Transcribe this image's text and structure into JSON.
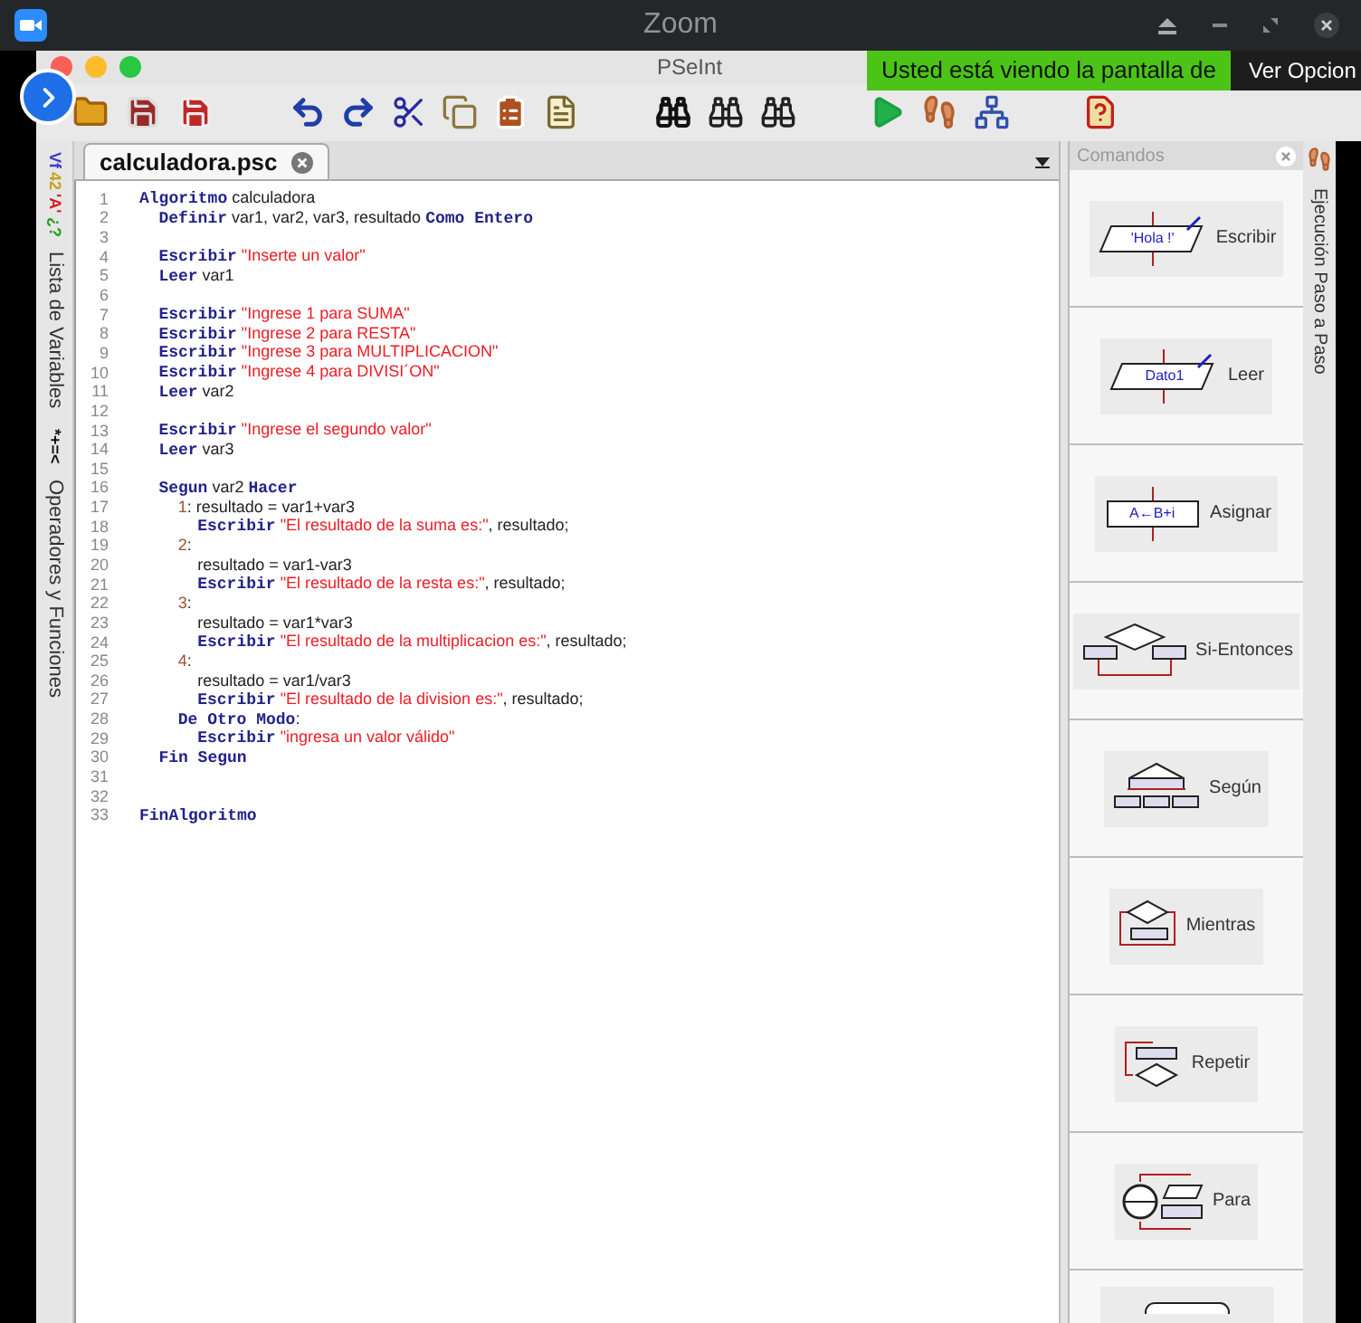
{
  "zoom_window": {
    "title": "Zoom"
  },
  "pseint_window": {
    "title": "PSeInt"
  },
  "share_banner": {
    "text": "Usted está viendo la pantalla de",
    "options": "Ver Opcion"
  },
  "left_tabs": [
    {
      "icon_text": [
        {
          "text": "Vf",
          "color": "#3a3ad0"
        },
        {
          "text": "42",
          "color": "#c8a020"
        },
        {
          "text": "'A'",
          "color": "#d02020"
        },
        {
          "text": "¿?",
          "color": "#20a020"
        }
      ],
      "label": "Lista de Variables"
    },
    {
      "icon_text": [
        {
          "text": "*+=<",
          "color": "#111111"
        }
      ],
      "label": "Operadores y Funciones"
    }
  ],
  "editor": {
    "tab": {
      "label": "calculadora.psc",
      "selected": true
    },
    "lines": [
      {
        "n": "1",
        "tokens": [
          {
            "kind": "keyword",
            "text": "Algoritmo"
          },
          {
            "kind": "text",
            "text": " calculadora"
          }
        ],
        "children": [
          {
            "n": "2",
            "tokens": [
              {
                "kind": "keyword",
                "text": "Definir"
              },
              {
                "kind": "text",
                "text": " var1, var2, var3, resultado "
              },
              {
                "kind": "keyword",
                "text": "Como Entero"
              }
            ]
          },
          {
            "n": "3"
          },
          {
            "n": "4",
            "tokens": [
              {
                "kind": "keyword",
                "text": "Escribir"
              },
              {
                "kind": "string",
                "text": " \"Inserte un valor\""
              }
            ]
          },
          {
            "n": "5",
            "tokens": [
              {
                "kind": "keyword",
                "text": "Leer"
              },
              {
                "kind": "text",
                "text": " var1"
              }
            ]
          },
          {
            "n": "6"
          },
          {
            "n": "7",
            "tokens": [
              {
                "kind": "keyword",
                "text": "Escribir"
              },
              {
                "kind": "string",
                "text": " \"Ingrese 1 para SUMA\""
              }
            ]
          },
          {
            "n": "8",
            "tokens": [
              {
                "kind": "keyword",
                "text": "Escribir"
              },
              {
                "kind": "string",
                "text": " \"Ingrese 2 para RESTA\""
              }
            ]
          },
          {
            "n": "9",
            "tokens": [
              {
                "kind": "keyword",
                "text": "Escribir"
              },
              {
                "kind": "string",
                "text": " \"Ingrese 3 para MULTIPLICACION\""
              }
            ]
          },
          {
            "n": "10",
            "tokens": [
              {
                "kind": "keyword",
                "text": "Escribir"
              },
              {
                "kind": "string",
                "text": " \"Ingrese 4 para DIVISI´ON\""
              }
            ]
          },
          {
            "n": "11",
            "tokens": [
              {
                "kind": "keyword",
                "text": "Leer"
              },
              {
                "kind": "text",
                "text": " var2"
              }
            ]
          },
          {
            "n": "12"
          },
          {
            "n": "13",
            "tokens": [
              {
                "kind": "keyword",
                "text": "Escribir"
              },
              {
                "kind": "string",
                "text": " \"Ingrese el segundo valor\""
              }
            ]
          },
          {
            "n": "14",
            "tokens": [
              {
                "kind": "keyword",
                "text": "Leer"
              },
              {
                "kind": "text",
                "text": " var3"
              }
            ]
          },
          {
            "n": "15"
          },
          {
            "n": "16",
            "tokens": [
              {
                "kind": "keyword",
                "text": "Segun"
              },
              {
                "kind": "text",
                "text": " var2 "
              },
              {
                "kind": "keyword",
                "text": "Hacer"
              }
            ],
            "children": [
              {
                "n": "17",
                "tokens": [
                  {
                    "kind": "number",
                    "text": "1"
                  },
                  {
                    "kind": "text",
                    "text": ": resultado = var1+var3"
                  }
                ],
                "children": [
                  {
                    "n": "18",
                    "tokens": [
                      {
                        "kind": "keyword",
                        "text": "Escribir"
                      },
                      {
                        "kind": "string",
                        "text": " \"El resultado de la suma es:\""
                      },
                      {
                        "kind": "text",
                        "text": ", resultado;"
                      }
                    ]
                  }
                ]
              },
              {
                "n": "19",
                "tokens": [
                  {
                    "kind": "number",
                    "text": "2"
                  },
                  {
                    "kind": "text",
                    "text": ":"
                  }
                ],
                "children": [
                  {
                    "n": "20",
                    "tokens": [
                      {
                        "kind": "text",
                        "text": "resultado = var1-var3"
                      }
                    ]
                  },
                  {
                    "n": "21",
                    "tokens": [
                      {
                        "kind": "keyword",
                        "text": "Escribir"
                      },
                      {
                        "kind": "string",
                        "text": " \"El resultado de la resta es:\""
                      },
                      {
                        "kind": "text",
                        "text": ", resultado;"
                      }
                    ]
                  }
                ]
              },
              {
                "n": "22",
                "tokens": [
                  {
                    "kind": "number",
                    "text": "3"
                  },
                  {
                    "kind": "text",
                    "text": ":"
                  }
                ],
                "children": [
                  {
                    "n": "23",
                    "tokens": [
                      {
                        "kind": "text",
                        "text": "resultado = var1*var3"
                      }
                    ]
                  },
                  {
                    "n": "24",
                    "tokens": [
                      {
                        "kind": "keyword",
                        "text": "Escribir"
                      },
                      {
                        "kind": "string",
                        "text": " \"El resultado de la multiplicacion es:\""
                      },
                      {
                        "kind": "text",
                        "text": ", resultado;"
                      }
                    ]
                  }
                ]
              },
              {
                "n": "25",
                "tokens": [
                  {
                    "kind": "number",
                    "text": "4"
                  },
                  {
                    "kind": "text",
                    "text": ":"
                  }
                ],
                "children": [
                  {
                    "n": "26",
                    "tokens": [
                      {
                        "kind": "text",
                        "text": "resultado = var1/var3"
                      }
                    ]
                  },
                  {
                    "n": "27",
                    "tokens": [
                      {
                        "kind": "keyword",
                        "text": "Escribir"
                      },
                      {
                        "kind": "string",
                        "text": " \"El resultado de la division es:\""
                      },
                      {
                        "kind": "text",
                        "text": ", resultado;"
                      }
                    ]
                  }
                ]
              },
              {
                "n": "28",
                "tokens": [
                  {
                    "kind": "keyword",
                    "text": "De Otro Modo"
                  },
                  {
                    "kind": "text",
                    "text": ":"
                  }
                ],
                "children": [
                  {
                    "n": "29",
                    "tokens": [
                      {
                        "kind": "keyword",
                        "text": "Escribir"
                      },
                      {
                        "kind": "string",
                        "text": " \"ingresa un valor válido\""
                      }
                    ]
                  }
                ]
              }
            ]
          },
          {
            "n": "30",
            "tokens": [
              {
                "kind": "keyword",
                "text": "Fin Segun"
              }
            ]
          },
          {
            "n": "31"
          },
          {
            "n": "32"
          }
        ]
      },
      {
        "n": "33",
        "tokens": [
          {
            "kind": "keyword",
            "text": "FinAlgoritmo"
          }
        ]
      }
    ]
  },
  "commands_panel": {
    "title": "Comandos",
    "items": [
      {
        "kind": "escribir",
        "label": "Escribir",
        "diagram_text": "'Hola !'"
      },
      {
        "kind": "leer",
        "label": "Leer",
        "diagram_text": "Dato1"
      },
      {
        "kind": "asignar",
        "label": "Asignar",
        "diagram_text": "A←B+i"
      },
      {
        "kind": "si",
        "label": "Si-Entonces"
      },
      {
        "kind": "segun",
        "label": "Según"
      },
      {
        "kind": "mientras",
        "label": "Mientras"
      },
      {
        "kind": "repetir",
        "label": "Repetir"
      },
      {
        "kind": "para",
        "label": "Para"
      },
      {
        "kind": "cut"
      }
    ]
  },
  "right_tab": {
    "label": "Ejecución Paso a Paso"
  }
}
